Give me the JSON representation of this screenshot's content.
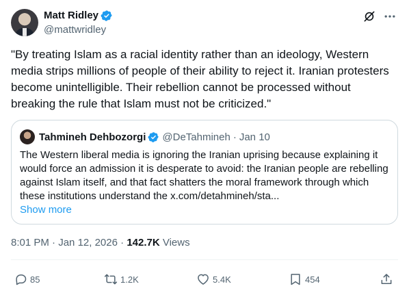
{
  "author": {
    "name": "Matt Ridley",
    "handle": "@mattwridley"
  },
  "tweet": {
    "text": "\"By treating Islam as a racial identity rather than an ideology, Western media strips millions of people of their ability to reject it. Iranian protesters become unintelligible. Their rebellion cannot be processed without breaking the rule that Islam must not be criticized.\""
  },
  "quote": {
    "name": "Tahmineh Dehbozorgi",
    "handle": "@DeTahmineh",
    "sep": "·",
    "date": "Jan 10",
    "text": "The Western liberal media is ignoring the Iranian uprising because explaining it would force an admission it is desperate to avoid: the Iranian people are rebelling against Islam itself, and that fact shatters the moral framework through which these institutions understand the x.com/detahmineh/sta...",
    "show_more": "Show more"
  },
  "meta": {
    "time": "8:01 PM",
    "sep": "·",
    "date": "Jan 12, 2026",
    "views_count": "142.7K",
    "views_label": "Views"
  },
  "actions": {
    "replies": "85",
    "reposts": "1.2K",
    "likes": "5.4K",
    "bookmarks": "454"
  },
  "colors": {
    "accent": "#1d9bf0",
    "secondary_text": "#536471",
    "border": "#cfd9de"
  },
  "icons": [
    "verified-badge-icon",
    "grok-icon",
    "more-icon",
    "reply-icon",
    "repost-icon",
    "like-icon",
    "bookmark-icon",
    "share-icon"
  ]
}
